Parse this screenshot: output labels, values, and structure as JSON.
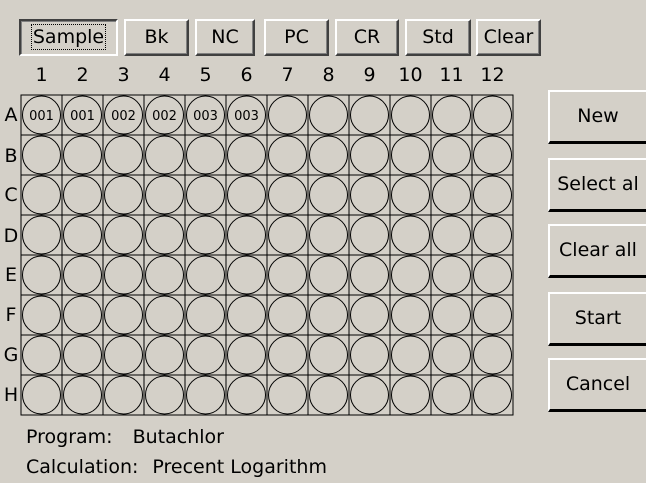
{
  "toolbar": {
    "buttons": [
      {
        "label": "Sample",
        "active": true
      },
      {
        "label": "Bk",
        "active": false
      },
      {
        "label": "NC",
        "active": false
      },
      {
        "label": "PC",
        "active": false
      },
      {
        "label": "CR",
        "active": false
      },
      {
        "label": "Std",
        "active": false
      },
      {
        "label": "Clear",
        "active": false
      }
    ]
  },
  "plate": {
    "columns": [
      "1",
      "2",
      "3",
      "4",
      "5",
      "6",
      "7",
      "8",
      "9",
      "10",
      "11",
      "12"
    ],
    "rows": [
      "A",
      "B",
      "C",
      "D",
      "E",
      "F",
      "G",
      "H"
    ],
    "filled_wells": {
      "A1": "001",
      "A2": "001",
      "A3": "002",
      "A4": "002",
      "A5": "003",
      "A6": "003"
    }
  },
  "side_buttons": {
    "new": "New",
    "select_all": "Select al",
    "clear_all": "Clear all",
    "start": "Start",
    "cancel": "Cancel"
  },
  "info": {
    "program_label": "Program:",
    "program_value": "Butachlor",
    "calculation_label": "Calculation:",
    "calculation_value": "Precent Logarithm"
  }
}
